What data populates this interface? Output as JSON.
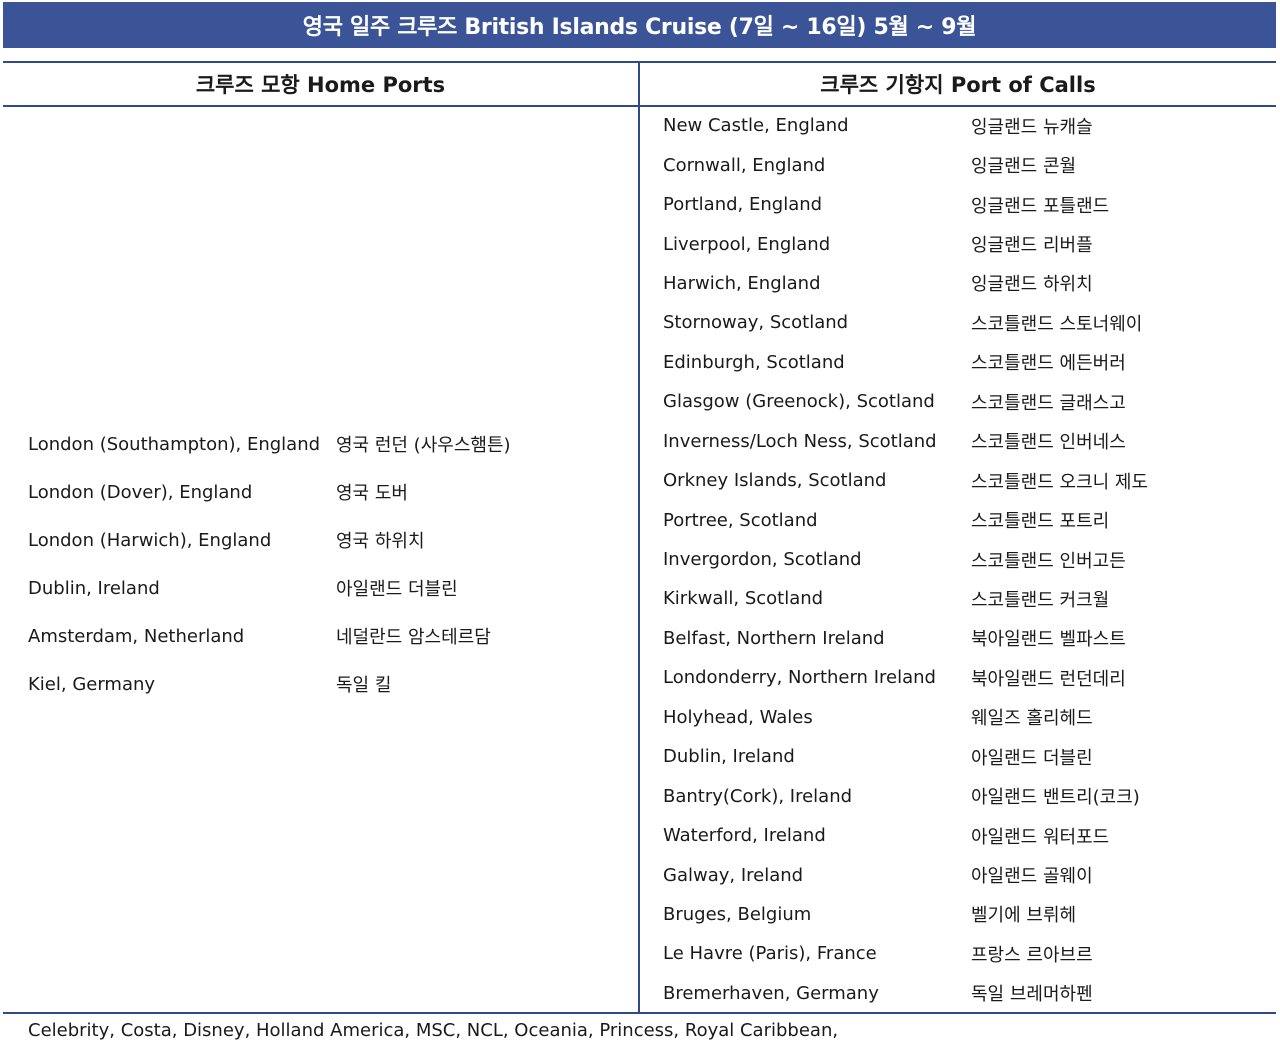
{
  "title": "영국 일주 크루즈 British Islands Cruise (7일 ~ 16일)  5월 ~ 9월",
  "headers": {
    "home_ports": "크루즈 모항 Home Ports",
    "port_of_calls": "크루즈 기항지 Port of Calls"
  },
  "home_ports": [
    {
      "en": "London (Southampton), England",
      "ko": "영국 런던 (사우스햄튼)"
    },
    {
      "en": "London (Dover), England",
      "ko": "영국 도버"
    },
    {
      "en": "London (Harwich), England",
      "ko": "영국 하위치"
    },
    {
      "en": "Dublin, Ireland",
      "ko": "아일랜드 더블린"
    },
    {
      "en": "Amsterdam, Netherland",
      "ko": "네덜란드 암스테르담"
    },
    {
      "en": "Kiel, Germany",
      "ko": "독일 킬"
    }
  ],
  "ports_of_call": [
    {
      "en": "New Castle, England",
      "ko": "잉글랜드 뉴캐슬"
    },
    {
      "en": "Cornwall, England",
      "ko": "잉글랜드 콘월"
    },
    {
      "en": "Portland, England",
      "ko": "잉글랜드 포틀랜드"
    },
    {
      "en": "Liverpool, England",
      "ko": "잉글랜드 리버플"
    },
    {
      "en": "Harwich, England",
      "ko": "잉글랜드 하위치"
    },
    {
      "en": "Stornoway, Scotland",
      "ko": "스코틀랜드 스토너웨이"
    },
    {
      "en": "Edinburgh, Scotland",
      "ko": "스코틀랜드 에든버러"
    },
    {
      "en": "Glasgow (Greenock), Scotland",
      "ko": "스코틀랜드 글래스고"
    },
    {
      "en": "Inverness/Loch Ness, Scotland",
      "ko": "스코틀랜드 인버네스"
    },
    {
      "en": "Orkney Islands, Scotland",
      "ko": "스코틀랜드 오크니 제도"
    },
    {
      "en": "Portree, Scotland",
      "ko": "스코틀랜드 포트리"
    },
    {
      "en": "Invergordon, Scotland",
      "ko": "스코틀랜드 인버고든"
    },
    {
      "en": "Kirkwall, Scotland",
      "ko": "스코틀랜드 커크월"
    },
    {
      "en": "Belfast, Northern Ireland",
      "ko": "북아일랜드 벨파스트"
    },
    {
      "en": "Londonderry, Northern Ireland",
      "ko": "북아일랜드 런던데리"
    },
    {
      "en": "Holyhead, Wales",
      "ko": "웨일즈 홀리헤드"
    },
    {
      "en": "Dublin, Ireland",
      "ko": "아일랜드 더블린"
    },
    {
      "en": "Bantry(Cork), Ireland",
      "ko": "아일랜드 밴트리(코크)"
    },
    {
      "en": "Waterford, Ireland",
      "ko": "아일랜드 워터포드"
    },
    {
      "en": "Galway, Ireland",
      "ko": "아일랜드 골웨이"
    },
    {
      "en": "Bruges, Belgium",
      "ko": "벨기에 브뤼헤"
    },
    {
      "en": "Le Havre (Paris), France",
      "ko": "프랑스 르아브르"
    },
    {
      "en": "Bremerhaven, Germany",
      "ko": "독일 브레머하펜"
    }
  ],
  "footer": "Celebrity, Costa, Disney, Holland America, MSC, NCL, Oceania, Princess, Royal Caribbean,",
  "colors": {
    "title_bg": "#3b5498",
    "rule": "#2f4a8a",
    "text": "#1a1a1a"
  }
}
